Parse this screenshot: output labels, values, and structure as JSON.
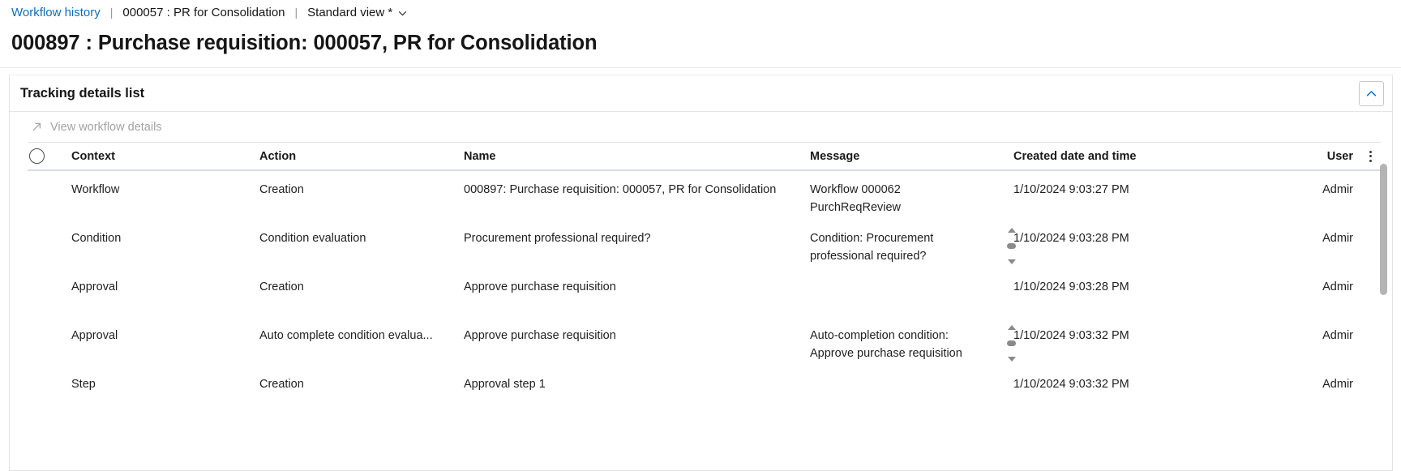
{
  "breadcrumb": {
    "link_label": "Workflow history",
    "separator": "|",
    "record_label": "000057 : PR for Consolidation",
    "view_label": "Standard view *",
    "chevron_icon": "chevron-down-icon"
  },
  "page": {
    "title": "000897 : Purchase requisition: 000057, PR for Consolidation"
  },
  "card": {
    "title": "Tracking details list",
    "collapse_icon": "chevron-up-icon"
  },
  "toolbar": {
    "view_workflow_details_label": "View workflow details",
    "view_workflow_details_icon": "open-in-new-icon",
    "view_workflow_details_disabled": "true"
  },
  "grid": {
    "select_all_icon": "select-all-circle-icon",
    "column_options_icon": "kebab-menu-icon",
    "columns": [
      "Context",
      "Action",
      "Name",
      "Message",
      "Created date and time",
      "User"
    ],
    "rows": [
      {
        "context": "Workflow",
        "action": "Creation",
        "name": "000897: Purchase requisition: 000057, PR for Consolidation",
        "message": "Workflow 000062 PurchReqReview",
        "created": "1/10/2024 9:03:27 PM",
        "user": "Admir",
        "has_scroll": false
      },
      {
        "context": "Condition",
        "action": "Condition evaluation",
        "name": "Procurement professional required?",
        "message": "Condition: Procurement professional required?",
        "created": "1/10/2024 9:03:28 PM",
        "user": "Admir",
        "has_scroll": true
      },
      {
        "context": "Approval",
        "action": "Creation",
        "name": "Approve purchase requisition",
        "message": "",
        "created": "1/10/2024 9:03:28 PM",
        "user": "Admir",
        "has_scroll": false
      },
      {
        "context": "Approval",
        "action": "Auto complete condition evalua...",
        "name": "Approve purchase requisition",
        "message": "Auto-completion condition: Approve purchase requisition",
        "created": "1/10/2024 9:03:32 PM",
        "user": "Admir",
        "has_scroll": true
      },
      {
        "context": "Step",
        "action": "Creation",
        "name": "Approval step 1",
        "message": "",
        "created": "1/10/2024 9:03:32 PM",
        "user": "Admir",
        "has_scroll": false
      }
    ]
  },
  "colors": {
    "link": "#0d6ebd",
    "text": "#161616",
    "muted": "#a3a3a3",
    "border": "#e3e3e3",
    "header_underline": "#d6dde8",
    "scrollbar": "#b4b4b4"
  }
}
